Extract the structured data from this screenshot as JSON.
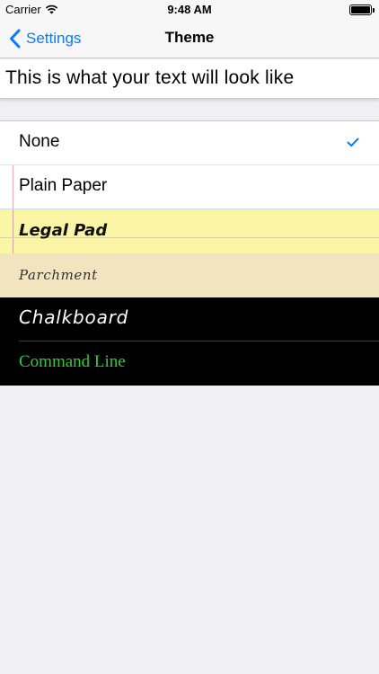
{
  "status_bar": {
    "carrier": "Carrier",
    "time": "9:48 AM"
  },
  "nav": {
    "back_label": "Settings",
    "title": "Theme"
  },
  "preview_text": "This is what your text will look like",
  "themes": [
    {
      "label": "None",
      "selected": true
    },
    {
      "label": "Plain Paper",
      "selected": false
    },
    {
      "label": "Legal Pad",
      "selected": false
    },
    {
      "label": "Parchment",
      "selected": false
    },
    {
      "label": "Chalkboard",
      "selected": false
    },
    {
      "label": "Command Line",
      "selected": false
    }
  ],
  "colors": {
    "accent": "#0a7aff",
    "legal_pad": "#fcf5a5",
    "parchment": "#f1e4be",
    "chalkboard": "#000000",
    "command_line_text": "#33cc33"
  },
  "icons": {
    "back": "chevron-left-icon",
    "selected": "checkmark-icon",
    "wifi": "wifi-icon",
    "battery": "battery-icon"
  }
}
